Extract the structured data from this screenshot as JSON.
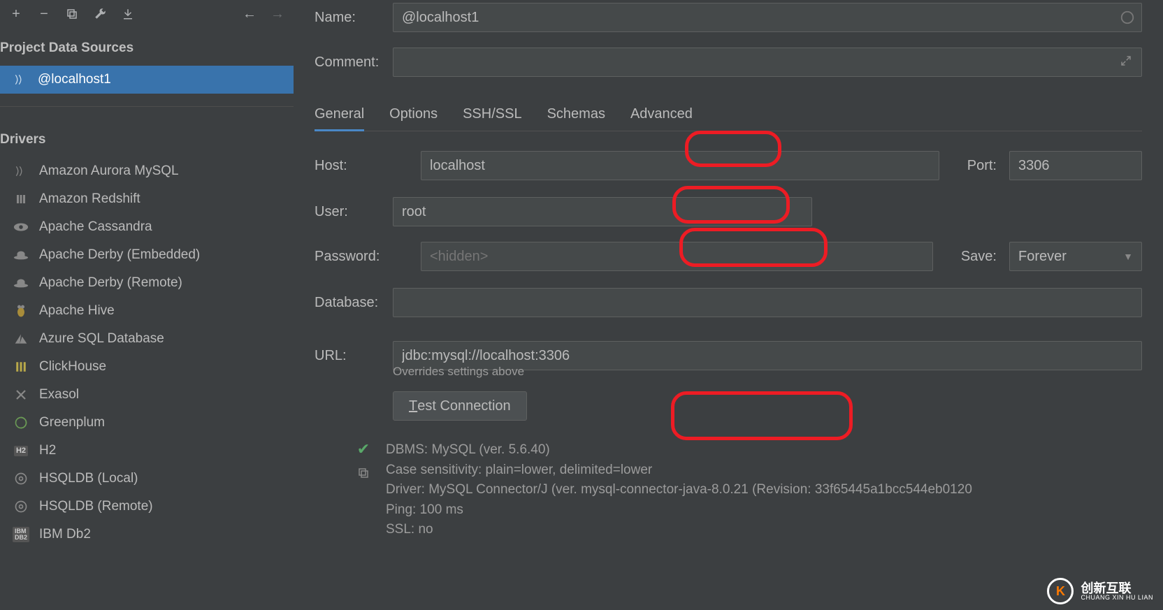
{
  "sidebar": {
    "sections": {
      "project_data_sources": "Project Data Sources",
      "drivers_head": "Drivers"
    },
    "selected_ds": "@localhost1",
    "drivers": [
      {
        "label": "Amazon Aurora MySQL",
        "icon": "aws"
      },
      {
        "label": "Amazon Redshift",
        "icon": "redshift"
      },
      {
        "label": "Apache Cassandra",
        "icon": "eye"
      },
      {
        "label": "Apache Derby (Embedded)",
        "icon": "hat"
      },
      {
        "label": "Apache Derby (Remote)",
        "icon": "hat"
      },
      {
        "label": "Apache Hive",
        "icon": "bee"
      },
      {
        "label": "Azure SQL Database",
        "icon": "azure"
      },
      {
        "label": "ClickHouse",
        "icon": "bars"
      },
      {
        "label": "Exasol",
        "icon": "x"
      },
      {
        "label": "Greenplum",
        "icon": "gp"
      },
      {
        "label": "H2",
        "icon": "h2"
      },
      {
        "label": "HSQLDB (Local)",
        "icon": "disc"
      },
      {
        "label": "HSQLDB (Remote)",
        "icon": "disc"
      },
      {
        "label": "IBM Db2",
        "icon": "ibm"
      }
    ]
  },
  "form": {
    "name_label": "Name:",
    "name_value": "@localhost1",
    "comment_label": "Comment:",
    "host_label": "Host:",
    "host_value": "localhost",
    "port_label": "Port:",
    "port_value": "3306",
    "user_label": "User:",
    "user_value": "root",
    "password_label": "Password:",
    "password_placeholder": "<hidden>",
    "save_label": "Save:",
    "save_value": "Forever",
    "database_label": "Database:",
    "url_label": "URL:",
    "url_value": "jdbc:mysql://localhost:3306",
    "overrides_note": "Overrides settings above",
    "test_btn_prefix": "T",
    "test_btn_rest": "est Connection"
  },
  "tabs": [
    "General",
    "Options",
    "SSH/SSL",
    "Schemas",
    "Advanced"
  ],
  "info": {
    "line1": "DBMS: MySQL (ver. 5.6.40)",
    "line2": "Case sensitivity: plain=lower, delimited=lower",
    "line3": "Driver: MySQL Connector/J (ver. mysql-connector-java-8.0.21 (Revision: 33f65445a1bcc544eb0120",
    "line4": "Ping: 100 ms",
    "line5": "SSL: no"
  },
  "watermark": {
    "cn": "创新互联",
    "en": "CHUANG XIN HU LIAN"
  }
}
